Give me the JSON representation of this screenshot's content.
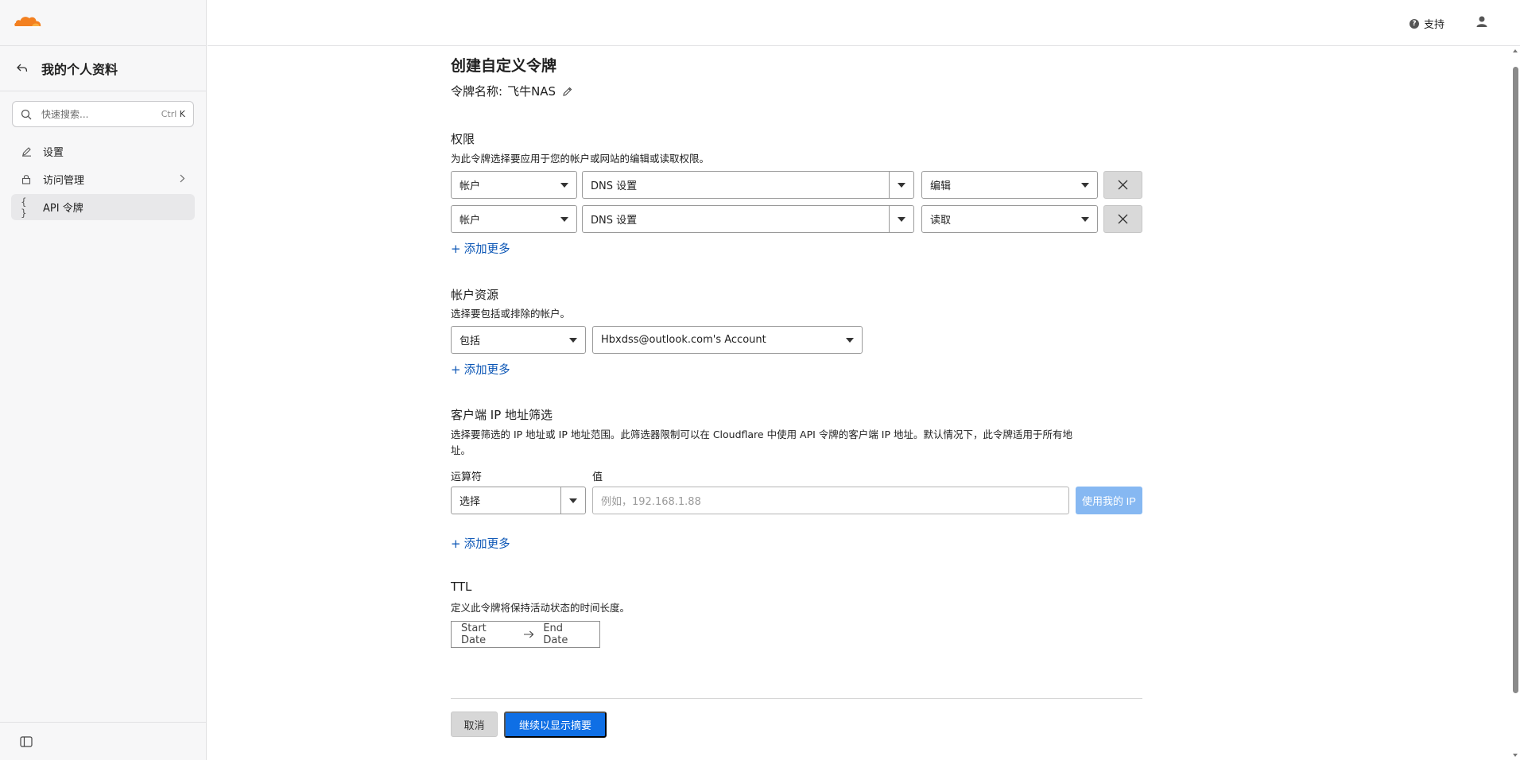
{
  "sidebar": {
    "profile_title": "我的个人资料",
    "search": {
      "placeholder": "快速搜索...",
      "shortcut_mod": "Ctrl",
      "shortcut_key": "K"
    },
    "items": [
      {
        "label": "设置",
        "icon": "pencil-icon"
      },
      {
        "label": "访问管理",
        "icon": "lock-icon"
      },
      {
        "label": "API 令牌",
        "icon": "braces-icon"
      }
    ]
  },
  "topbar": {
    "support_label": "支持"
  },
  "page": {
    "title": "创建自定义令牌",
    "token_name_label": "令牌名称:",
    "token_name_value": "飞牛NAS"
  },
  "permissions": {
    "title": "权限",
    "description": "为此令牌选择要应用于您的帐户或网站的编辑或读取权限。",
    "rows": [
      {
        "scope": "帐户",
        "resource": "DNS 设置",
        "access": "编辑"
      },
      {
        "scope": "帐户",
        "resource": "DNS 设置",
        "access": "读取"
      }
    ],
    "add_more": "添加更多"
  },
  "account_resources": {
    "title": "帐户资源",
    "description": "选择要包括或排除的帐户。",
    "mode": "包括",
    "account": "Hbxdss@outlook.com's Account",
    "add_more": "添加更多"
  },
  "ip_filter": {
    "title": "客户端 IP 地址筛选",
    "description_line1": "选择要筛选的 IP 地址或 IP 地址范围。此筛选器限制可以在 Cloudflare 中使用 API 令牌的客户端 IP 地址。默认情况下，此令牌适用于所有地",
    "description_line2": "址。",
    "operator_label": "运算符",
    "value_label": "值",
    "operator_value": "选择",
    "value_placeholder": "例如，192.168.1.88",
    "use_my_ip": "使用我的 IP",
    "add_more": "添加更多"
  },
  "ttl": {
    "title": "TTL",
    "description": "定义此令牌将保持活动状态的时间长度。",
    "start_placeholder": "Start Date",
    "end_placeholder": "End Date"
  },
  "actions": {
    "cancel": "取消",
    "continue": "继续以显示摘要"
  },
  "colors": {
    "accent": "#0f6fe5",
    "link": "#0a55b5",
    "brand_orange": "#f38020"
  }
}
